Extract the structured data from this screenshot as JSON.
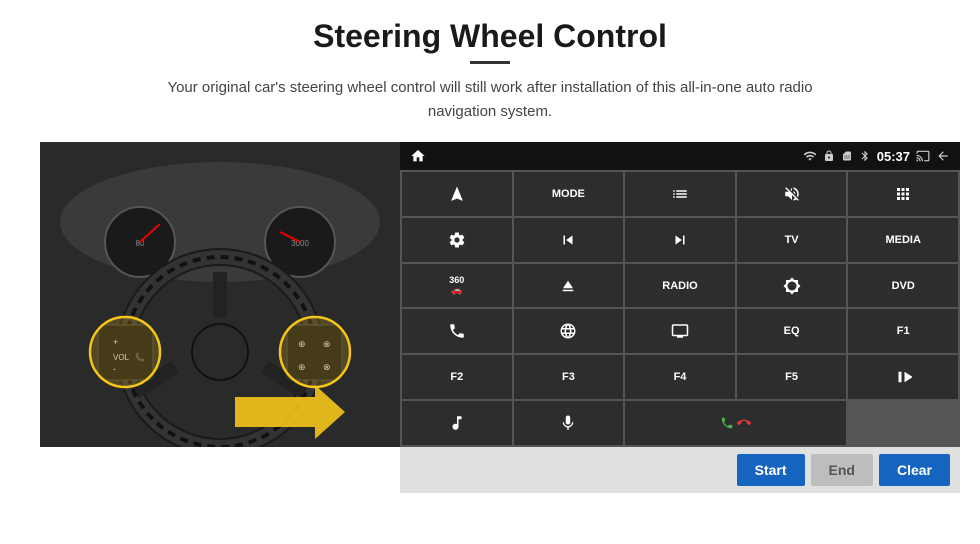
{
  "page": {
    "title": "Steering Wheel Control",
    "subtitle": "Your original car's steering wheel control will still work after installation of this all-in-one auto radio navigation system.",
    "divider": true
  },
  "status_bar": {
    "time": "05:37",
    "icons": [
      "wifi",
      "lock",
      "sim",
      "bluetooth",
      "cast",
      "back"
    ]
  },
  "buttons": [
    {
      "id": "nav",
      "type": "icon",
      "icon": "navigate",
      "row": 1,
      "col": 1
    },
    {
      "id": "mode",
      "label": "MODE",
      "row": 1,
      "col": 2
    },
    {
      "id": "list",
      "type": "icon",
      "icon": "list",
      "row": 1,
      "col": 3
    },
    {
      "id": "mute",
      "type": "icon",
      "icon": "mute",
      "row": 1,
      "col": 4
    },
    {
      "id": "apps",
      "type": "icon",
      "icon": "apps",
      "row": 1,
      "col": 5
    },
    {
      "id": "settings",
      "type": "icon",
      "icon": "settings",
      "row": 2,
      "col": 1
    },
    {
      "id": "prev",
      "type": "icon",
      "icon": "prev",
      "row": 2,
      "col": 2
    },
    {
      "id": "next",
      "type": "icon",
      "icon": "next",
      "row": 2,
      "col": 3
    },
    {
      "id": "tv",
      "label": "TV",
      "row": 2,
      "col": 4
    },
    {
      "id": "media",
      "label": "MEDIA",
      "row": 2,
      "col": 5
    },
    {
      "id": "cam360",
      "type": "icon",
      "icon": "360cam",
      "row": 3,
      "col": 1
    },
    {
      "id": "eject",
      "type": "icon",
      "icon": "eject",
      "row": 3,
      "col": 2
    },
    {
      "id": "radio",
      "label": "RADIO",
      "row": 3,
      "col": 3
    },
    {
      "id": "brightness",
      "type": "icon",
      "icon": "brightness",
      "row": 3,
      "col": 4
    },
    {
      "id": "dvd",
      "label": "DVD",
      "row": 3,
      "col": 5
    },
    {
      "id": "phone",
      "type": "icon",
      "icon": "phone",
      "row": 4,
      "col": 1
    },
    {
      "id": "globe",
      "type": "icon",
      "icon": "globe",
      "row": 4,
      "col": 2
    },
    {
      "id": "screen",
      "type": "icon",
      "icon": "screen",
      "row": 4,
      "col": 3
    },
    {
      "id": "eq",
      "label": "EQ",
      "row": 4,
      "col": 4
    },
    {
      "id": "f1",
      "label": "F1",
      "row": 4,
      "col": 5
    },
    {
      "id": "f2",
      "label": "F2",
      "row": 5,
      "col": 1
    },
    {
      "id": "f3",
      "label": "F3",
      "row": 5,
      "col": 2
    },
    {
      "id": "f4",
      "label": "F4",
      "row": 5,
      "col": 3
    },
    {
      "id": "f5",
      "label": "F5",
      "row": 5,
      "col": 4
    },
    {
      "id": "playpause",
      "type": "icon",
      "icon": "playpause",
      "row": 5,
      "col": 5
    },
    {
      "id": "music",
      "type": "icon",
      "icon": "music",
      "row": 6,
      "col": 1
    },
    {
      "id": "mic",
      "type": "icon",
      "icon": "mic",
      "row": 6,
      "col": 2
    },
    {
      "id": "call",
      "type": "icon",
      "icon": "call",
      "row": 6,
      "col": 3,
      "span": 2
    }
  ],
  "action_bar": {
    "start_label": "Start",
    "end_label": "End",
    "clear_label": "Clear"
  }
}
